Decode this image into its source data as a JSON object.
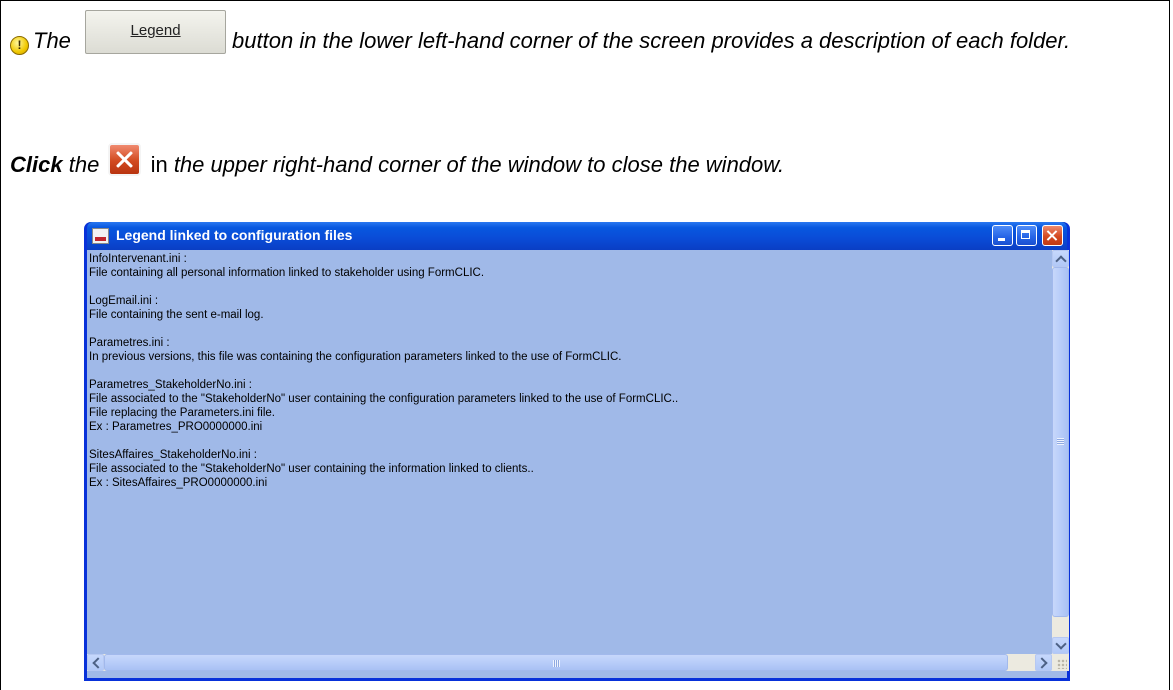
{
  "instructions": {
    "line1_prefix": "The",
    "legend_button_label": "Legend",
    "line1_rest": "button in the lower left-hand corner of the screen provides a description of each folder.",
    "line2_click": "Click",
    "line2_the": "the",
    "line2_in": "in",
    "line2_rest": "the upper right-hand corner of the window to close the window."
  },
  "window": {
    "title": "Legend linked to configuration files",
    "lines": [
      "InfoIntervenant.ini :",
      "File containing all personal information linked to stakeholder using FormCLIC.",
      "",
      "LogEmail.ini :",
      "File containing the sent e-mail log.",
      "",
      "Parametres.ini :",
      "In previous versions, this file was containing the configuration parameters linked to the use of FormCLIC.",
      "",
      "Parametres_StakeholderNo.ini :",
      "File associated to the \"StakeholderNo\" user containing the configuration parameters linked to the use of FormCLIC..",
      "File replacing the Parameters.ini file.",
      "Ex : Parametres_PRO0000000.ini",
      "",
      "SitesAffaires_StakeholderNo.ini :",
      "File associated to the \"StakeholderNo\" user containing the information linked to clients..",
      "Ex : SitesAffaires_PRO0000000.ini"
    ]
  },
  "colors": {
    "titlebar": "#0a4bd6",
    "client_bg": "#a0b9e8",
    "close_red": "#d24a20"
  },
  "icons": {
    "warning": "warning-icon",
    "close": "close-icon",
    "app": "formclic-app-icon"
  }
}
